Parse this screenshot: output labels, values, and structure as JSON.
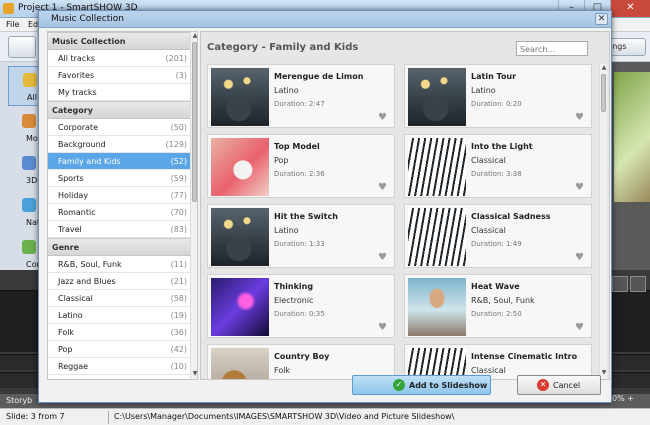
{
  "app": {
    "title": "Project 1 - SmartSHOW 3D",
    "menu": [
      "File",
      "Edit"
    ],
    "toolbar_right_label": "ings",
    "left_items": [
      "All Ef",
      "Mo",
      "3D-e",
      "Nat",
      "Com"
    ],
    "storyboard_label": "Storyb",
    "zoom_label": "0%  +",
    "status_slide": "Slide: 3 from 7",
    "status_path": "C:\\Users\\Manager\\Documents\\IMAGES\\SMARTSHOW 3D\\Video and Picture Slideshow\\"
  },
  "dialog": {
    "title": "Music Collection",
    "close_glyph": "✕",
    "sidebar": {
      "sections": [
        {
          "header": "Music Collection",
          "items": [
            {
              "label": "All tracks",
              "count": "(201)"
            },
            {
              "label": "Favorites",
              "count": "(3)"
            },
            {
              "label": "My tracks",
              "count": ""
            }
          ]
        },
        {
          "header": "Category",
          "items": [
            {
              "label": "Corporate",
              "count": "(50)"
            },
            {
              "label": "Background",
              "count": "(129)"
            },
            {
              "label": "Family and Kids",
              "count": "(52)",
              "selected": true
            },
            {
              "label": "Sports",
              "count": "(59)"
            },
            {
              "label": "Holiday",
              "count": "(77)"
            },
            {
              "label": "Romantic",
              "count": "(70)"
            },
            {
              "label": "Travel",
              "count": "(83)"
            }
          ]
        },
        {
          "header": "Genre",
          "items": [
            {
              "label": "R&B, Soul, Funk",
              "count": "(11)"
            },
            {
              "label": "Jazz and Blues",
              "count": "(21)"
            },
            {
              "label": "Classical",
              "count": "(58)"
            },
            {
              "label": "Latino",
              "count": "(19)"
            },
            {
              "label": "Folk",
              "count": "(36)"
            },
            {
              "label": "Pop",
              "count": "(42)"
            },
            {
              "label": "Reggae",
              "count": "(10)"
            }
          ]
        }
      ]
    },
    "main": {
      "category_title": "Category - Family and Kids",
      "search_placeholder": "Search...",
      "tracks": [
        {
          "title": "Merengue de Limon",
          "genre": "Latino",
          "duration": "Duration: 2:47",
          "thumb": "lamps"
        },
        {
          "title": "Latin Tour",
          "genre": "Latino",
          "duration": "Duration: 0:20",
          "thumb": "lamps"
        },
        {
          "title": "Top Model",
          "genre": "Pop",
          "duration": "Duration: 2:36",
          "thumb": "headphones"
        },
        {
          "title": "Into the Light",
          "genre": "Classical",
          "duration": "Duration: 3:38",
          "thumb": "sheet-music"
        },
        {
          "title": "Hit the Switch",
          "genre": "Latino",
          "duration": "Duration: 1:33",
          "thumb": "lamps"
        },
        {
          "title": "Classical Sadness",
          "genre": "Classical",
          "duration": "Duration: 1:49",
          "thumb": "sheet-music"
        },
        {
          "title": "Thinking",
          "genre": "Electronic",
          "duration": "Duration: 0:35",
          "thumb": "dj"
        },
        {
          "title": "Heat Wave",
          "genre": "R&B, Soul, Funk",
          "duration": "Duration: 2:50",
          "thumb": "skater"
        },
        {
          "title": "Country Boy",
          "genre": "Folk",
          "duration": "Duration: 2:27",
          "thumb": "guitar"
        },
        {
          "title": "Intense Cinematic Intro",
          "genre": "Classical",
          "duration": "Duration: 1:19",
          "thumb": "sheet-music"
        }
      ]
    },
    "buttons": {
      "add_label": "Add to Slideshow",
      "cancel_label": "Cancel"
    }
  }
}
